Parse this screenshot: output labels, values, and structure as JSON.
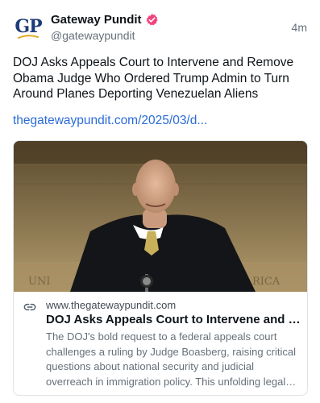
{
  "author": {
    "avatar_text": "GP",
    "display_name": "Gateway Pundit",
    "handle": "@gatewaypundit",
    "verified_color": "#f0457f"
  },
  "post": {
    "timestamp": "4m",
    "text": "DOJ Asks Appeals Court to Intervene and Remove Obama Judge Who Ordered Trump Admin to Turn Around Planes Deporting Venezuelan Aliens",
    "link_text": "thegatewaypundit.com/2025/03/d..."
  },
  "link_card": {
    "domain": "www.thegatewaypundit.com",
    "title": "DOJ Asks Appeals Court to Intervene and Remove Obama Judge Who Ordered Trump Admin to Turn Around Planes Deporting Venezuelan Aliens",
    "description": "The DOJ's bold request to a federal appeals court challenges a ruling by Judge Boasberg, raising critical questions about national security and judicial overreach in immigration policy. This unfolding legal drama demands attention."
  },
  "colors": {
    "link": "#2a6bd8",
    "brand_blue": "#1e3c7a",
    "brand_gold": "#e0a81c"
  },
  "icons": [
    "verified-badge-icon",
    "link-icon"
  ]
}
